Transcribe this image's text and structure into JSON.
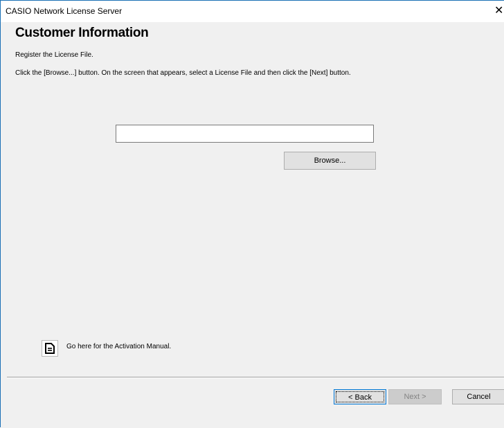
{
  "window": {
    "title": "CASIO Network License Server",
    "close_glyph": "✕"
  },
  "page": {
    "heading": "Customer Information",
    "subheading": "Register the License File.",
    "instruction": "Click the [Browse...] button. On the screen that appears, select a License File and then click the [Next] button."
  },
  "license_file": {
    "value": "",
    "placeholder": "",
    "browse_label": "Browse..."
  },
  "manual": {
    "icon": "document-icon",
    "link_text": "Go here for the Activation Manual."
  },
  "footer": {
    "back_label": "< Back",
    "next_label": "Next >",
    "cancel_label": "Cancel",
    "next_enabled": false
  },
  "colors": {
    "window_border": "#1a6fb5",
    "dialog_background": "#f0f0f0",
    "button_face": "#e1e1e1",
    "focus_border": "#0078d7",
    "disabled_text": "#838383"
  }
}
